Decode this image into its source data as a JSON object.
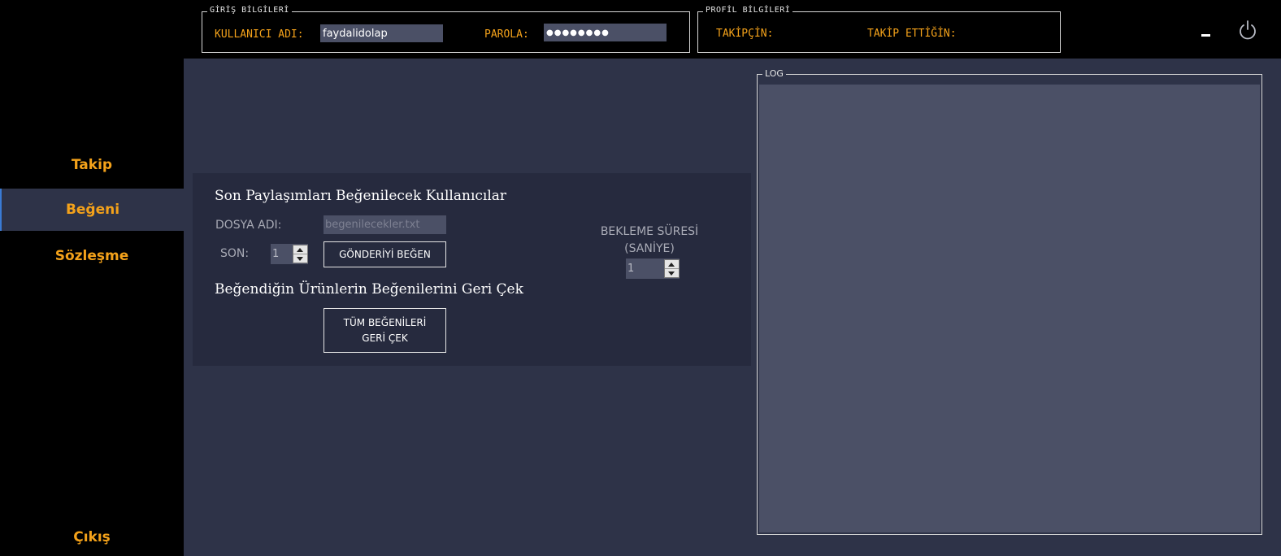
{
  "login": {
    "group_title": "GİRİŞ BİLGİLERİ",
    "username_label": "KULLANICI ADI:",
    "username_value": "faydalidolap",
    "password_label": "PAROLA:",
    "password_value": "●●●●●●●●"
  },
  "profile": {
    "group_title": "PROFİL BİLGİLERİ",
    "followers_label": "TAKİPÇİN:",
    "following_label": "TAKİP ETTİĞİN:"
  },
  "window_controls": {
    "minimize_icon": "minimize-icon",
    "power_icon": "power-icon"
  },
  "sidebar": {
    "items": [
      {
        "label": "Takip",
        "active": false
      },
      {
        "label": "Beğeni",
        "active": true
      },
      {
        "label": "Sözleşme",
        "active": false
      }
    ],
    "exit_label": "Çıkış"
  },
  "like_panel": {
    "section1_title": "Son Paylaşımları Beğenilecek Kullanıcılar",
    "file_label": "DOSYA ADI:",
    "file_value": "begenilecekler.txt",
    "last_label": "SON:",
    "last_value": "1",
    "like_post_button": "GÖNDERİYİ BEĞEN",
    "wait_label_line1": "BEKLEME SÜRESİ",
    "wait_label_line2": "(SANİYE)",
    "wait_value": "1",
    "section2_title": "Beğendiğin Ürünlerin Beğenilerini Geri Çek",
    "unlike_all_line1": "TÜM BEĞENİLERİ",
    "unlike_all_line2": "GERİ ÇEK"
  },
  "log": {
    "title": "LOG",
    "content": ""
  },
  "colors": {
    "accent_orange": "#f4a21a",
    "background_main": "#2e3348",
    "panel_dark": "#262a3e",
    "input_bg": "#4b5066",
    "sidebar_bg": "#000000",
    "active_indicator": "#3a7bd5"
  }
}
